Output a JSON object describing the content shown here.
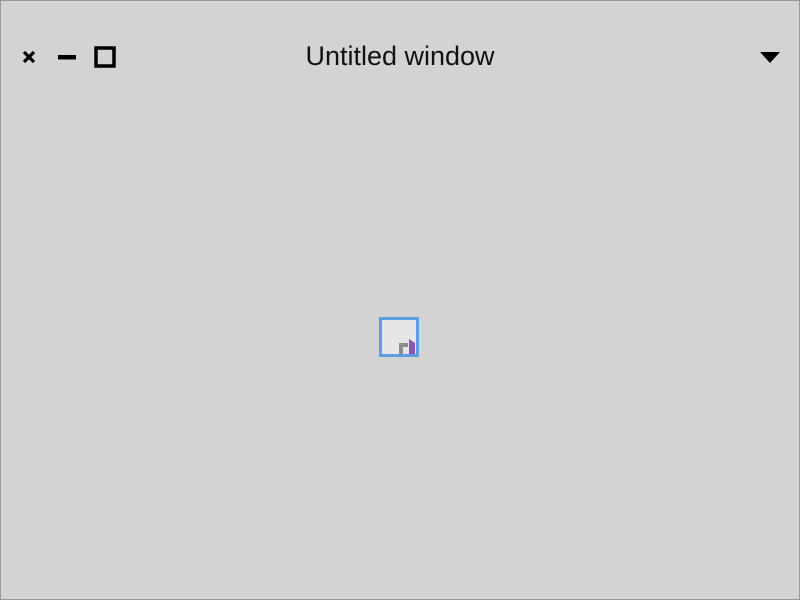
{
  "window": {
    "title": "Untitled window"
  },
  "controls": {
    "close_icon": "close-icon",
    "minimize_icon": "minimize-icon",
    "maximize_icon": "maximize-icon",
    "menu_icon": "dropdown-triangle-icon"
  },
  "content": {
    "center_widget_icon": "resize-handle-icon"
  },
  "colors": {
    "background": "#d3d3d3",
    "border": "#9a9a9a",
    "title_text": "#111111",
    "widget_border": "#5b9fe0",
    "widget_fill": "#e6e6e6",
    "widget_accent": "#8a56b0"
  }
}
